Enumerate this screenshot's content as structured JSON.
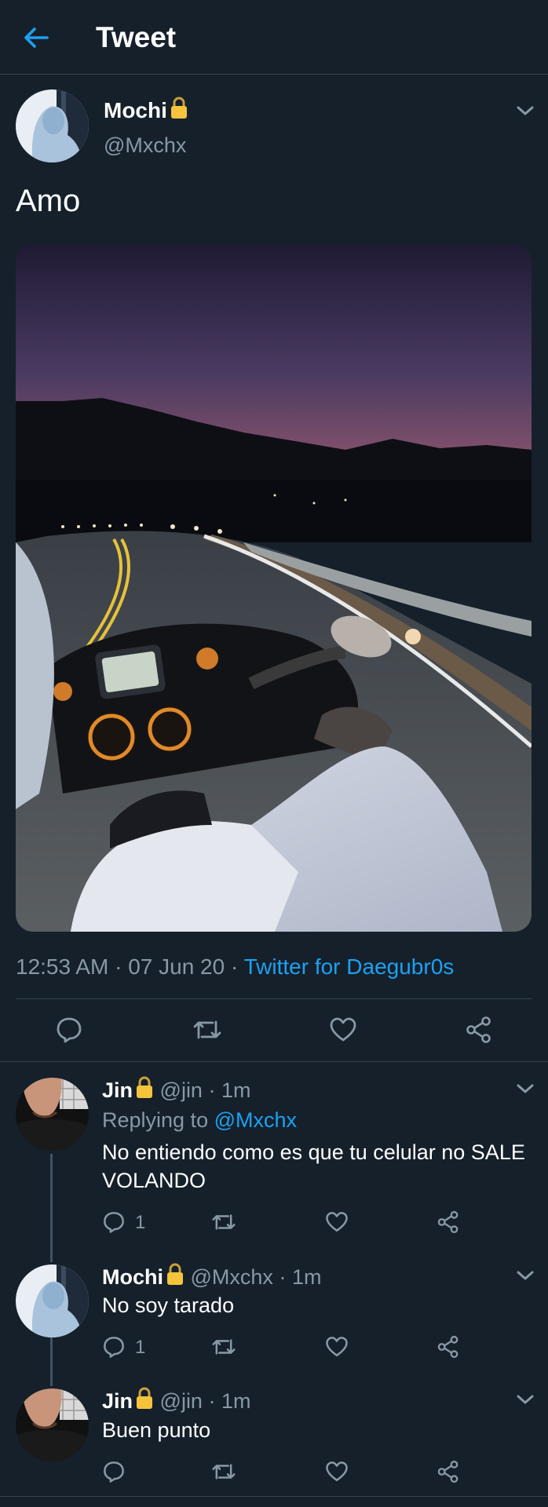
{
  "header": {
    "title": "Tweet",
    "back_icon": "arrow-left-icon"
  },
  "colors": {
    "background": "#15202b",
    "accent": "#1da1f2",
    "muted": "#8899a6",
    "divider": "#38444d"
  },
  "main_tweet": {
    "name": "Mochi",
    "handle": "@Mxchx",
    "text": "Amo",
    "time": "12:53 AM",
    "date": "07 Jun 20",
    "source": "Twitter for Daegubr0s",
    "dot": "·"
  },
  "replies": [
    {
      "name": "Jin",
      "handle": "@jin",
      "time": "1m",
      "replying_prefix": "Replying to",
      "replying_handle": "@Mxchx",
      "text": "No entiendo como es que tu celular no SALE VOLANDO",
      "reply_count": "1"
    },
    {
      "name": "Mochi",
      "handle": "@Mxchx",
      "time": "1m",
      "text": "No soy tarado",
      "reply_count": "1"
    },
    {
      "name": "Jin",
      "handle": "@jin",
      "time": "1m",
      "text": "Buen punto"
    }
  ]
}
